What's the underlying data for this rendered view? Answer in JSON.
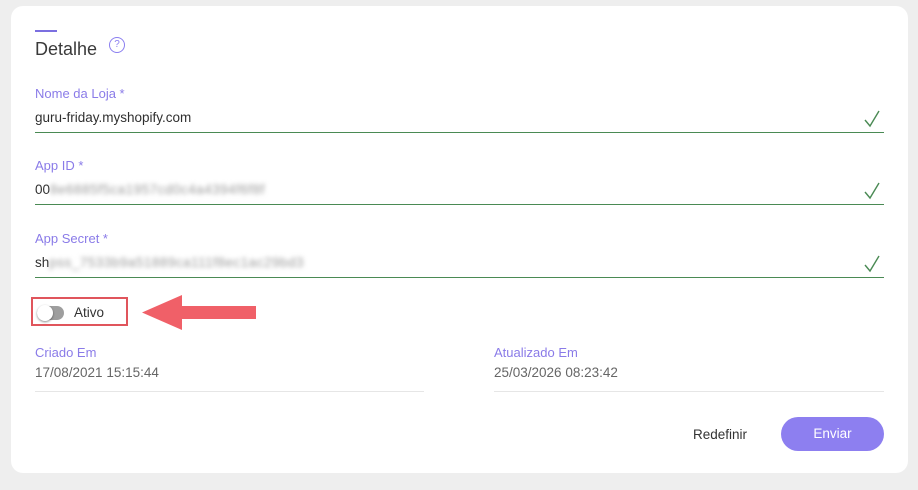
{
  "section": {
    "title": "Detalhe",
    "help_icon": "?"
  },
  "fields": [
    {
      "label": "Nome da Loja *",
      "value": "guru-friday.myshopify.com",
      "blurred": "",
      "valid": true
    },
    {
      "label": "App ID *",
      "value": "00",
      "blurred": "8e6885f5ca1957cd0c4a4394f6f8f",
      "valid": true
    },
    {
      "label": "App Secret *",
      "value": "sh",
      "blurred": "pss_7533b9a51889ca111f8ec1ac29bd3",
      "valid": true
    }
  ],
  "toggle": {
    "label": "Ativo",
    "on": false
  },
  "meta": {
    "created": {
      "label": "Criado Em",
      "value": "17/08/2021 15:15:44"
    },
    "updated": {
      "label": "Atualizado Em",
      "value": "25/03/2026 08:23:42"
    }
  },
  "actions": {
    "reset_label": "Redefinir",
    "submit_label": "Enviar"
  },
  "colors": {
    "accent": "#8d7ff0",
    "valid_line": "#4a8a54",
    "highlight": "#e0555c"
  }
}
